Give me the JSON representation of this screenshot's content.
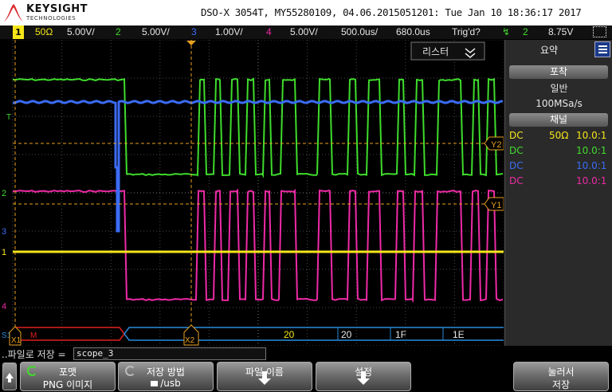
{
  "header": {
    "brand": "KEYSIGHT",
    "brand_sub": "TECHNOLOGIES",
    "instrument_info": "DSO-X 3054T, MY55280109, 04.06.2015051201: Tue Jan 10 18:36:17 2017"
  },
  "channel_bar": {
    "ch1_num": "1",
    "ch1_impedance": "50Ω",
    "ch1_scale": "5.00V/",
    "ch2_num": "2",
    "ch2_scale": "5.00V/",
    "ch3_num": "3",
    "ch3_scale": "1.00V/",
    "ch4_num": "4",
    "ch4_scale": "5.00V/",
    "timebase": "500.0us/",
    "delay": "680.0us",
    "trigger_status": "Trig'd?",
    "trigger_source": "2",
    "trigger_level": "8.75V"
  },
  "plot": {
    "reset_label": "리스터",
    "bus_values": [
      "20",
      "20",
      "1F",
      "1E"
    ],
    "markers": {
      "x1": "X1",
      "x2": "X2",
      "y1": "Y1",
      "y2": "Y2",
      "s1": "S1",
      "m": "M"
    },
    "channel_markers": [
      "1",
      "2",
      "3",
      "4"
    ],
    "trigger_marker": "T"
  },
  "side_panel": {
    "title": "요약",
    "acquisition_header": "포착",
    "acquisition_mode": "일반",
    "sample_rate": "100MSa/s",
    "channels_header": "채널",
    "channels": [
      {
        "coupling": "DC",
        "impedance": "50Ω",
        "probe": "10.0:1",
        "color": "#f5e61a"
      },
      {
        "coupling": "DC",
        "impedance": "",
        "probe": "10.0:1",
        "color": "#3fdc2c"
      },
      {
        "coupling": "DC",
        "impedance": "",
        "probe": "10.0:1",
        "color": "#3b6cf5"
      },
      {
        "coupling": "DC",
        "impedance": "",
        "probe": "10.0:1",
        "color": "#ee2aa6"
      }
    ]
  },
  "file_row": {
    "label": "..파일로 저장 =",
    "filename": "scope_3"
  },
  "softkeys": {
    "format_label": "포맷",
    "format_value": "PNG 이미지",
    "save_method_label": "저장 방법",
    "save_method_value": "/usb",
    "file_name_label": "파일 이름",
    "settings_label": "설정",
    "press_to_save_l1": "눌러서",
    "press_to_save_l2": "저장"
  },
  "colors": {
    "ch1": "#f5e61a",
    "ch2": "#3fdc2c",
    "ch3": "#3b6cf5",
    "ch4": "#ee2aa6",
    "cursor": "#e8a020",
    "bus_red": "#e02020",
    "bus_blue": "#2a8ad8"
  }
}
